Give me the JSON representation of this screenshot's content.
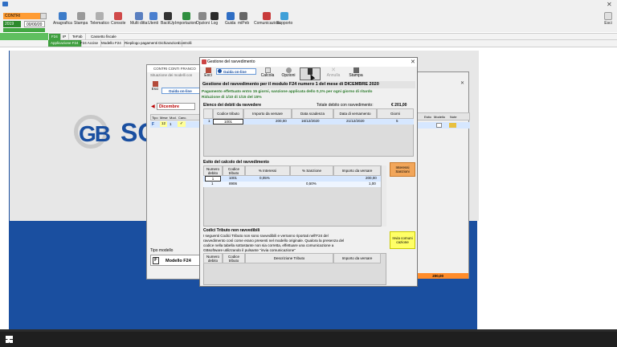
{
  "toolbar": {
    "combo_name": "CONTRI",
    "year": "2019",
    "date": "00/00/20",
    "buttons": [
      {
        "label": "Anagrafica",
        "icon": "contacts-icon",
        "color": "#3d7cc9"
      },
      {
        "label": "Stampa",
        "icon": "printer-icon",
        "color": "#9a9a9a"
      },
      {
        "label": "Telematico",
        "icon": "telematic-icon",
        "color": "#b0b0b0"
      },
      {
        "label": "Console",
        "icon": "console-icon",
        "color": "#d04a4a"
      },
      {
        "label": "Multi ditta",
        "icon": "multi-company-icon",
        "color": "#5a7fc0"
      },
      {
        "label": "Utenti",
        "icon": "users-icon",
        "color": "#4a7fcf"
      },
      {
        "label": "BackUp",
        "icon": "backup-icon",
        "color": "#333333"
      },
      {
        "label": "Importazioni",
        "icon": "import-icon",
        "color": "#2f8f3f"
      },
      {
        "label": "Opzioni",
        "icon": "options-icon",
        "color": "#888888"
      },
      {
        "label": "Log",
        "icon": "log-icon",
        "color": "#2a2a2a"
      },
      {
        "label": "Guida",
        "icon": "help-icon",
        "color": "#2f6ec4"
      },
      {
        "label": "miPeb",
        "icon": "mipeb-icon",
        "color": "#666666"
      },
      {
        "label": "Comunicazioni",
        "icon": "messages-icon",
        "color": "#c83a3a"
      },
      {
        "label": "Supporto",
        "icon": "support-icon",
        "color": "#3fa0d8"
      }
    ],
    "esci_label": "Esci"
  },
  "subtabs_row1": [
    "F24",
    "IP",
    "TeFab",
    "Cassetto fiscale"
  ],
  "subtabs_row2": [
    "Applicazione F24",
    "F24 Accise",
    "Modello F24",
    "Riepilogo pagamenti Dichiarazioni",
    "Controlli"
  ],
  "bg_window": {
    "title": "CONTRI CONTI FRANCO",
    "subtitle": "Situazione dei modelli con",
    "guida_label": "Guida on-line",
    "esci_label": "Esci",
    "month": "Dicembre",
    "columns": [
      "Tipo",
      "Mese",
      "Mod.",
      "Canc."
    ],
    "row": {
      "tipo": "F",
      "mese": "12",
      "mod": "1",
      "canc": "✓"
    },
    "right_columns": [
      "Esito",
      "Modello",
      "Note"
    ],
    "tipo_modello_label": "Tipo modello",
    "modello_value": "Modello F24",
    "total_value": "200,00"
  },
  "dialog": {
    "title": "Gestione del ravvedimento",
    "buttons": [
      {
        "label": "Esci"
      },
      {
        "label": "Guida on-line"
      },
      {
        "label": "Calcola"
      },
      {
        "label": "Opzioni"
      },
      {
        "label": "Conferma"
      },
      {
        "label": "Annulla"
      },
      {
        "label": "Stampa"
      }
    ],
    "heading": "Gestione del ravvedimento per il modulo F24 numero 1 del mese di DICEMBRE 2020",
    "green_note_line1": "Pagamento effettuato entro 15 giorni, sanzione applicata dello 0,1% per ogni giorno di ritardo",
    "green_note_line2": "Riduzione di 1/10 di 1/15 del 15%",
    "debts": {
      "title": "Elenco dei debiti da ravvedere",
      "total_label": "Totale debito con ravvedimento:",
      "total_value": "€ 201,00",
      "columns": [
        "",
        "Codice tributo",
        "Importo da versare",
        "Data scadenza",
        "Data di versamento",
        "Giorni"
      ],
      "rows": [
        {
          "num": "1",
          "codice": "1001",
          "importo": "200,00",
          "scadenza": "16/12/2020",
          "versamento": "21/12/2020",
          "giorni": "5"
        }
      ]
    },
    "calc": {
      "title": "Esito del calcolo del ravvedimento",
      "columns": [
        "Numero debito",
        "Codice tributo",
        "% Interessi",
        "% Sanzione",
        "Importo da versare"
      ],
      "rows": [
        {
          "num": "1",
          "codice": "1001",
          "interessi": "0,05%",
          "sanzione": "",
          "importo": "200,00"
        },
        {
          "num": "1",
          "codice": "8906",
          "interessi": "",
          "sanzione": "0,50%",
          "importo": "1,00"
        }
      ],
      "side_button": "Interessi Sanzioni"
    },
    "nonravv": {
      "title": "Codici Tributo non ravvedibili",
      "text_lines": [
        "I seguenti Codici Tributo non sono ravvedibili e verranno riportati nell'F24 del",
        "ravvedimento così come erano presenti nel modello originale. Qualora la presenza del",
        "codice nella tabella sottostante non sia corretta, effettuare una comunicazione a",
        "GBsoftware utilizzando il pulsante \"invia comunicazione\""
      ],
      "columns": [
        "Numero debito",
        "Codice tributo",
        "Descrizione Tributo",
        "Importo da versare"
      ],
      "side_button": "Invia comuni cazione"
    }
  },
  "logo_text": "SO"
}
